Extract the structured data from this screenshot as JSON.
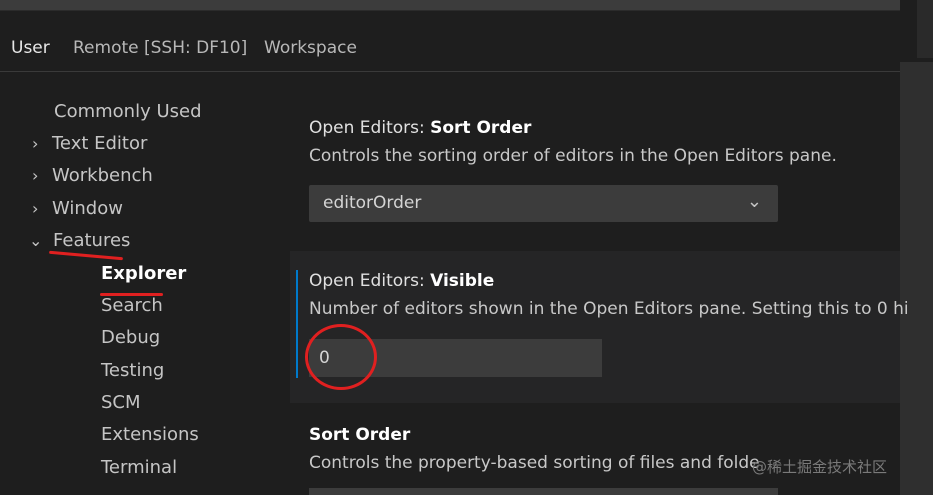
{
  "tabs": [
    {
      "label": "User",
      "active": true
    },
    {
      "label": "Remote [SSH: DF10]",
      "active": false
    },
    {
      "label": "Workspace",
      "active": false
    }
  ],
  "tree": {
    "items": [
      {
        "label": "Commonly Used",
        "chevron": ""
      },
      {
        "label": "Text Editor",
        "chevron": "chevron-right"
      },
      {
        "label": "Workbench",
        "chevron": "chevron-right"
      },
      {
        "label": "Window",
        "chevron": "chevron-right"
      },
      {
        "label": "Features",
        "chevron": "chevron-down"
      },
      {
        "label": "Explorer",
        "selected": true
      },
      {
        "label": "Search"
      },
      {
        "label": "Debug"
      },
      {
        "label": "Testing"
      },
      {
        "label": "SCM"
      },
      {
        "label": "Extensions"
      },
      {
        "label": "Terminal"
      }
    ]
  },
  "settings": {
    "sort_order_editors": {
      "category": "Open Editors: ",
      "name": "Sort Order",
      "description": "Controls the sorting order of editors in the Open Editors pane.",
      "value": "editorOrder"
    },
    "visible": {
      "category": "Open Editors: ",
      "name": "Visible",
      "description": "Number of editors shown in the Open Editors pane. Setting this to 0 hi",
      "value": "0"
    },
    "sort_order": {
      "name": "Sort Order",
      "description": "Controls the property-based sorting of files and folde"
    }
  },
  "watermark": "@稀土掘金技术社区",
  "colors": {
    "background": "#1e1e1e",
    "focus_bar": "#007acc",
    "annotation_red": "#e02020"
  }
}
